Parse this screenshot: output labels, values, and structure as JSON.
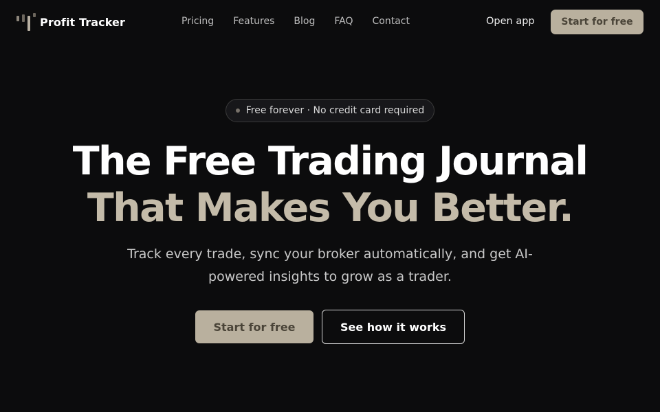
{
  "nav": {
    "brand": "Profit Tracker",
    "links": [
      {
        "label": "Pricing"
      },
      {
        "label": "Features"
      },
      {
        "label": "Blog"
      },
      {
        "label": "FAQ"
      },
      {
        "label": "Contact"
      }
    ],
    "open_app": "Open app",
    "cta": "Start for free"
  },
  "hero": {
    "badge": "Free forever · No credit card required",
    "headline_line1": "The Free Trading Journal",
    "headline_line2": "That Makes You Better.",
    "subtext": "Track every trade, sync your broker automatically, and get AI-powered insights to grow as a trader.",
    "primary_cta": "Start for free",
    "secondary_cta": "See how it works"
  },
  "colors": {
    "background": "#0c0c0d",
    "accent": "#b9b09e",
    "accent_text": "#4a4438",
    "headline_accent": "#c4bba9"
  },
  "icons": {
    "logo": "bar-chart-logo-icon",
    "badge_dot": "status-dot-icon"
  }
}
